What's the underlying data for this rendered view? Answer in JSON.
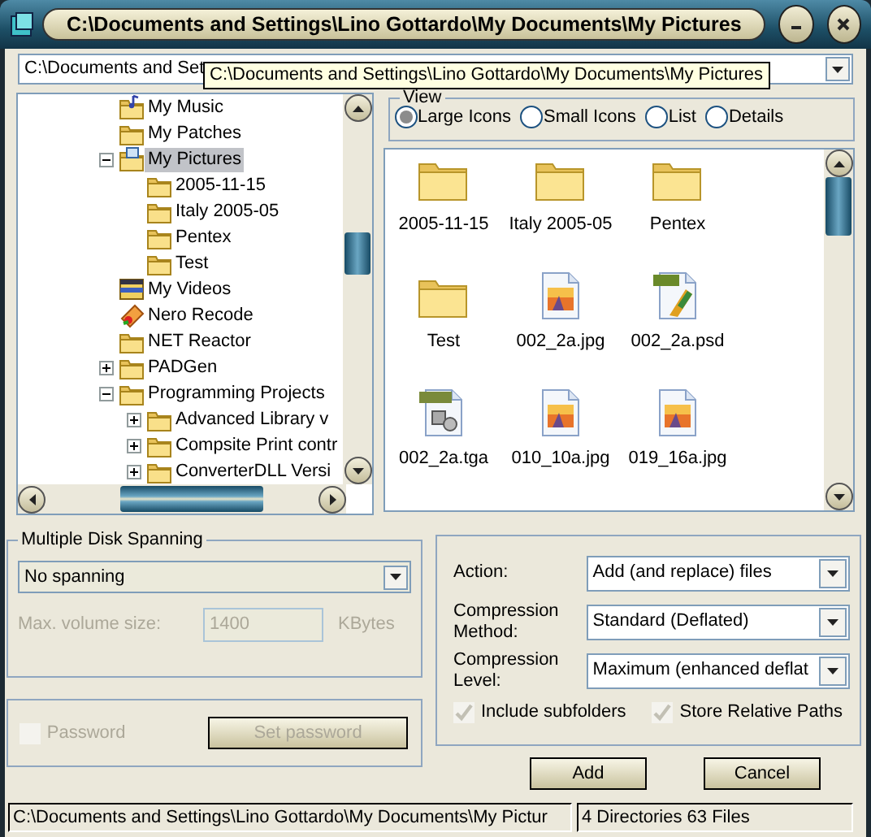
{
  "window": {
    "title": "C:\\Documents and Settings\\Lino Gottardo\\My Documents\\My Pictures"
  },
  "path_combo": {
    "value": "C:\\Documents and Set"
  },
  "tooltip": {
    "text": "C:\\Documents and Settings\\Lino Gottardo\\My Documents\\My Pictures"
  },
  "tree": {
    "items": [
      {
        "label": "My Music",
        "kind": "music",
        "selected": false
      },
      {
        "label": "My Patches",
        "kind": "folder",
        "selected": false
      },
      {
        "label": "My Pictures",
        "kind": "pictures",
        "selected": true,
        "expanded": true,
        "children": [
          {
            "label": "2005-11-15",
            "kind": "folder",
            "selected": false
          },
          {
            "label": "Italy 2005-05",
            "kind": "folder",
            "selected": false
          },
          {
            "label": "Pentex",
            "kind": "folder",
            "selected": false
          },
          {
            "label": "Test",
            "kind": "folder",
            "selected": false
          }
        ]
      },
      {
        "label": "My Videos",
        "kind": "video",
        "selected": false
      },
      {
        "label": "Nero Recode",
        "kind": "nero",
        "selected": false
      },
      {
        "label": "NET Reactor",
        "kind": "folder",
        "selected": false
      },
      {
        "label": "PADGen",
        "kind": "folder",
        "selected": false,
        "expanded": false
      },
      {
        "label": "Programming Projects",
        "kind": "folder",
        "selected": false,
        "expanded": true,
        "children": [
          {
            "label": "Advanced Library v",
            "kind": "folder",
            "selected": false,
            "expanded": false
          },
          {
            "label": "Compsite Print contr",
            "kind": "folder",
            "selected": false,
            "expanded": false
          },
          {
            "label": "ConverterDLL Versi",
            "kind": "folder",
            "selected": false,
            "expanded": false
          }
        ]
      }
    ]
  },
  "view": {
    "title": "View",
    "options": [
      {
        "label": "Large Icons",
        "selected": true
      },
      {
        "label": "Small Icons",
        "selected": false
      },
      {
        "label": "List",
        "selected": false
      },
      {
        "label": "Details",
        "selected": false
      }
    ]
  },
  "files": [
    {
      "label": "2005-11-15",
      "kind": "folder"
    },
    {
      "label": "Italy 2005-05",
      "kind": "folder"
    },
    {
      "label": "Pentex",
      "kind": "folder"
    },
    {
      "label": "Test",
      "kind": "folder"
    },
    {
      "label": "002_2a.jpg",
      "kind": "image"
    },
    {
      "label": "002_2a.psd",
      "kind": "psd"
    },
    {
      "label": "002_2a.tga",
      "kind": "tga"
    },
    {
      "label": "010_10a.jpg",
      "kind": "image"
    },
    {
      "label": "019_16a.jpg",
      "kind": "image"
    }
  ],
  "spanning": {
    "title": "Multiple Disk Spanning",
    "mode": "No spanning",
    "volume_label": "Max. volume size:",
    "volume_value": "1400",
    "volume_disabled": true,
    "unit": "KBytes"
  },
  "password": {
    "label": "Password",
    "checked": false,
    "disabled": true,
    "button": "Set password"
  },
  "options": {
    "fields": [
      {
        "label": "Action:",
        "value": "Add (and replace) files"
      },
      {
        "label": "Compression Method:",
        "value": "Standard (Deflated)"
      },
      {
        "label": "Compression Level:",
        "value": "Maximum  (enhanced deflat"
      }
    ],
    "checkboxes": [
      {
        "label": "Include subfolders",
        "checked": true,
        "disabled": true
      },
      {
        "label": "Store Relative Paths",
        "checked": true,
        "disabled": true
      }
    ]
  },
  "buttons": [
    {
      "label": "Add"
    },
    {
      "label": "Cancel"
    }
  ],
  "status_bar": {
    "path": "C:\\Documents and Settings\\Lino Gottardo\\My Documents\\My Pictur",
    "summary": "4 Directories 63 Files"
  }
}
